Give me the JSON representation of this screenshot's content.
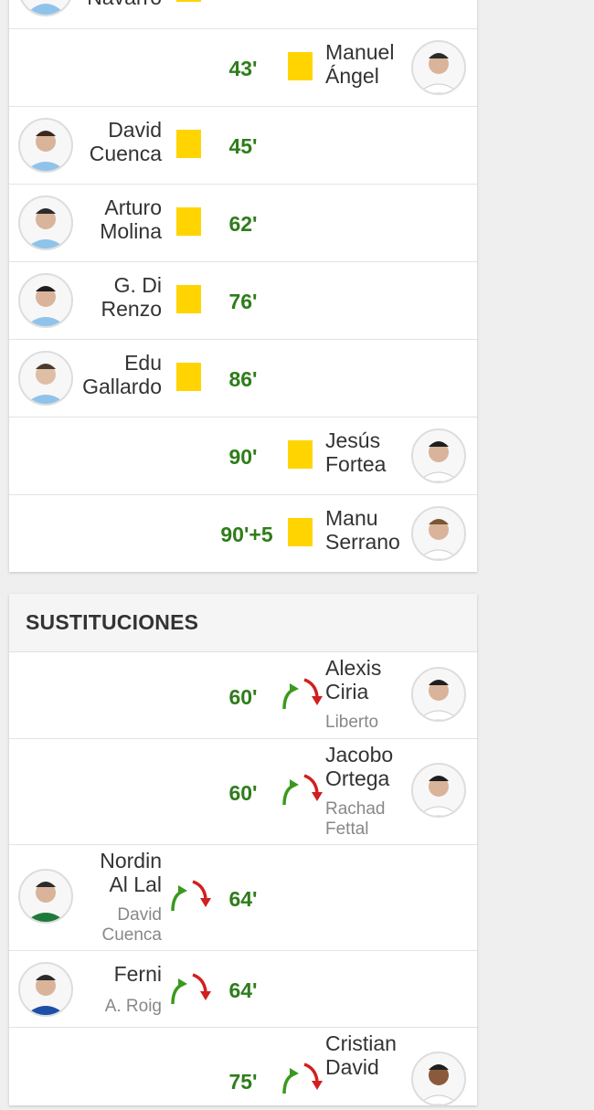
{
  "cards": {
    "rows": [
      {
        "side": "left",
        "name_lines": [
          "",
          "Navarro"
        ],
        "minute": "",
        "top_cut": true
      },
      {
        "side": "right",
        "name_lines": [
          "Manuel",
          "Ángel"
        ],
        "minute": "43'"
      },
      {
        "side": "left",
        "name_lines": [
          "David",
          "Cuenca"
        ],
        "minute": "45'"
      },
      {
        "side": "left",
        "name_lines": [
          "Arturo",
          "Molina"
        ],
        "minute": "62'"
      },
      {
        "side": "left",
        "name_lines": [
          "G. Di",
          "Renzo"
        ],
        "minute": "76'"
      },
      {
        "side": "left",
        "name_lines": [
          "Edu",
          "Gallardo"
        ],
        "minute": "86'"
      },
      {
        "side": "right",
        "name_lines": [
          "Jesús",
          "Fortea"
        ],
        "minute": "90'"
      },
      {
        "side": "right",
        "name_lines": [
          "Manu",
          "Serrano"
        ],
        "minute": "90'+5"
      }
    ]
  },
  "substitutions": {
    "title": "SUSTITUCIONES",
    "rows": [
      {
        "side": "right",
        "in_lines": [
          "Alexis",
          "Ciria"
        ],
        "out_lines": [
          "Liberto"
        ],
        "minute": "60'"
      },
      {
        "side": "right",
        "in_lines": [
          "Jacobo",
          "Ortega"
        ],
        "out_lines": [
          "Rachad",
          "Fettal"
        ],
        "minute": "60'"
      },
      {
        "side": "left",
        "in_lines": [
          "Nordin",
          "Al Lal"
        ],
        "out_lines": [
          "David",
          "Cuenca"
        ],
        "minute": "64'"
      },
      {
        "side": "left",
        "in_lines": [
          "Ferni"
        ],
        "out_lines": [
          "A. Roig"
        ],
        "minute": "64'"
      },
      {
        "side": "right",
        "in_lines": [
          "Cristian",
          "David"
        ],
        "out_lines": [],
        "minute": "75'"
      }
    ]
  },
  "colors": {
    "minute": "#2e7d1a",
    "yellow_card": "#ffd400",
    "arrow_in": "#3a9a1e",
    "arrow_out": "#d21f1f",
    "home_kit": "#8fc3ea",
    "away_kit": "#ffffff",
    "green_kit": "#1f7a3a",
    "blue_kit": "#1b4fa8"
  },
  "icons": {
    "yellow_card": "yellow-card-icon",
    "swap": "substitution-arrows-icon",
    "avatar": "player-avatar"
  }
}
